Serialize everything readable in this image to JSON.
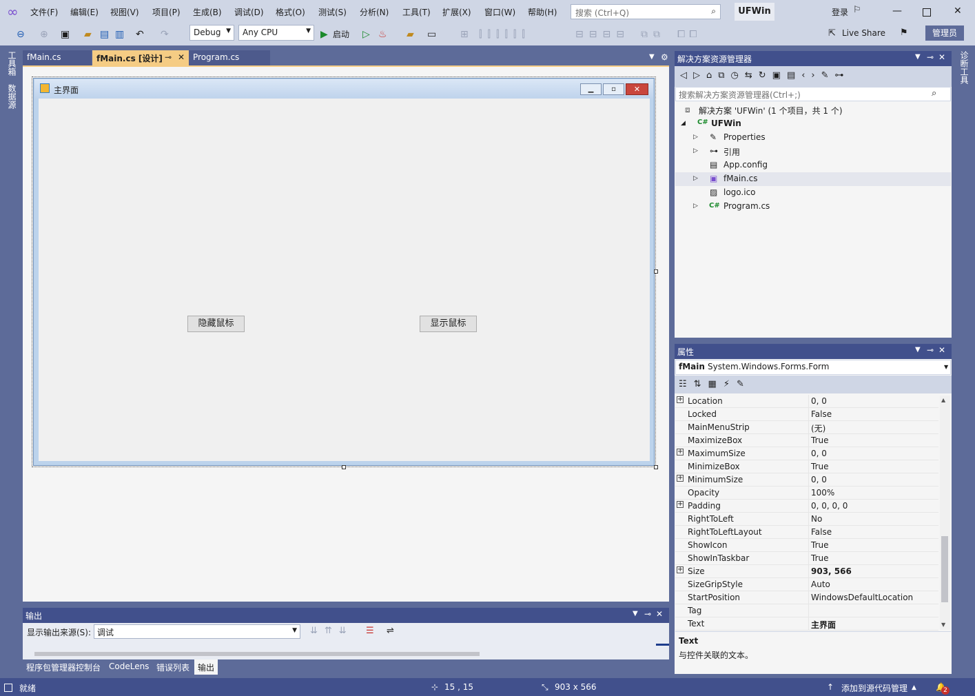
{
  "menu": [
    "文件(F)",
    "编辑(E)",
    "视图(V)",
    "项目(P)",
    "生成(B)",
    "调试(D)",
    "格式(O)",
    "测试(S)",
    "分析(N)",
    "工具(T)",
    "扩展(X)",
    "窗口(W)",
    "帮助(H)"
  ],
  "search": {
    "placeholder": "搜索 (Ctrl+Q)"
  },
  "solution_name": "UFWin",
  "login": "登录",
  "toolbar": {
    "config": "Debug",
    "platform": "Any CPU",
    "start": "启动",
    "live_share": "Live Share",
    "admin": "管理员"
  },
  "left_tabs": [
    "工具箱",
    "数据源"
  ],
  "right_tabs": [
    "诊断工具"
  ],
  "doc_tabs": [
    {
      "label": "fMain.cs"
    },
    {
      "label": "fMain.cs [设计]"
    },
    {
      "label": "Program.cs"
    }
  ],
  "form": {
    "title": "主界面",
    "button_hide": "隐藏鼠标",
    "button_show": "显示鼠标"
  },
  "output": {
    "title": "输出",
    "source_label": "显示输出来源(S):",
    "source_value": "调试"
  },
  "bottom_tabs": [
    "程序包管理器控制台",
    "CodeLens",
    "错误列表",
    "输出"
  ],
  "solution_explorer": {
    "title": "解决方案资源管理器",
    "search_placeholder": "搜索解决方案资源管理器(Ctrl+;)",
    "solution_line": "解决方案 'UFWin' (1 个项目，共 1 个)",
    "project": "UFWin",
    "items": [
      "Properties",
      "引用",
      "App.config",
      "fMain.cs",
      "logo.ico",
      "Program.cs"
    ]
  },
  "properties": {
    "title": "属性",
    "object_name": "fMain",
    "object_type": "System.Windows.Forms.Form",
    "rows": [
      {
        "name": "Location",
        "value": "0, 0",
        "expandable": true
      },
      {
        "name": "Locked",
        "value": "False"
      },
      {
        "name": "MainMenuStrip",
        "value": "(无)"
      },
      {
        "name": "MaximizeBox",
        "value": "True"
      },
      {
        "name": "MaximumSize",
        "value": "0, 0",
        "expandable": true
      },
      {
        "name": "MinimizeBox",
        "value": "True"
      },
      {
        "name": "MinimumSize",
        "value": "0, 0",
        "expandable": true
      },
      {
        "name": "Opacity",
        "value": "100%"
      },
      {
        "name": "Padding",
        "value": "0, 0, 0, 0",
        "expandable": true
      },
      {
        "name": "RightToLeft",
        "value": "No"
      },
      {
        "name": "RightToLeftLayout",
        "value": "False"
      },
      {
        "name": "ShowIcon",
        "value": "True"
      },
      {
        "name": "ShowInTaskbar",
        "value": "True"
      },
      {
        "name": "Size",
        "value": "903, 566",
        "expandable": true,
        "bold": true
      },
      {
        "name": "SizeGripStyle",
        "value": "Auto"
      },
      {
        "name": "StartPosition",
        "value": "WindowsDefaultLocation"
      },
      {
        "name": "Tag",
        "value": ""
      },
      {
        "name": "Text",
        "value": "主界面",
        "bold": true
      }
    ],
    "desc_title": "Text",
    "desc_text": "与控件关联的文本。"
  },
  "status": {
    "ready": "就绪",
    "position": "15 , 15",
    "size": "903 x 566",
    "source_control": "添加到源代码管理",
    "notifications": "2"
  }
}
